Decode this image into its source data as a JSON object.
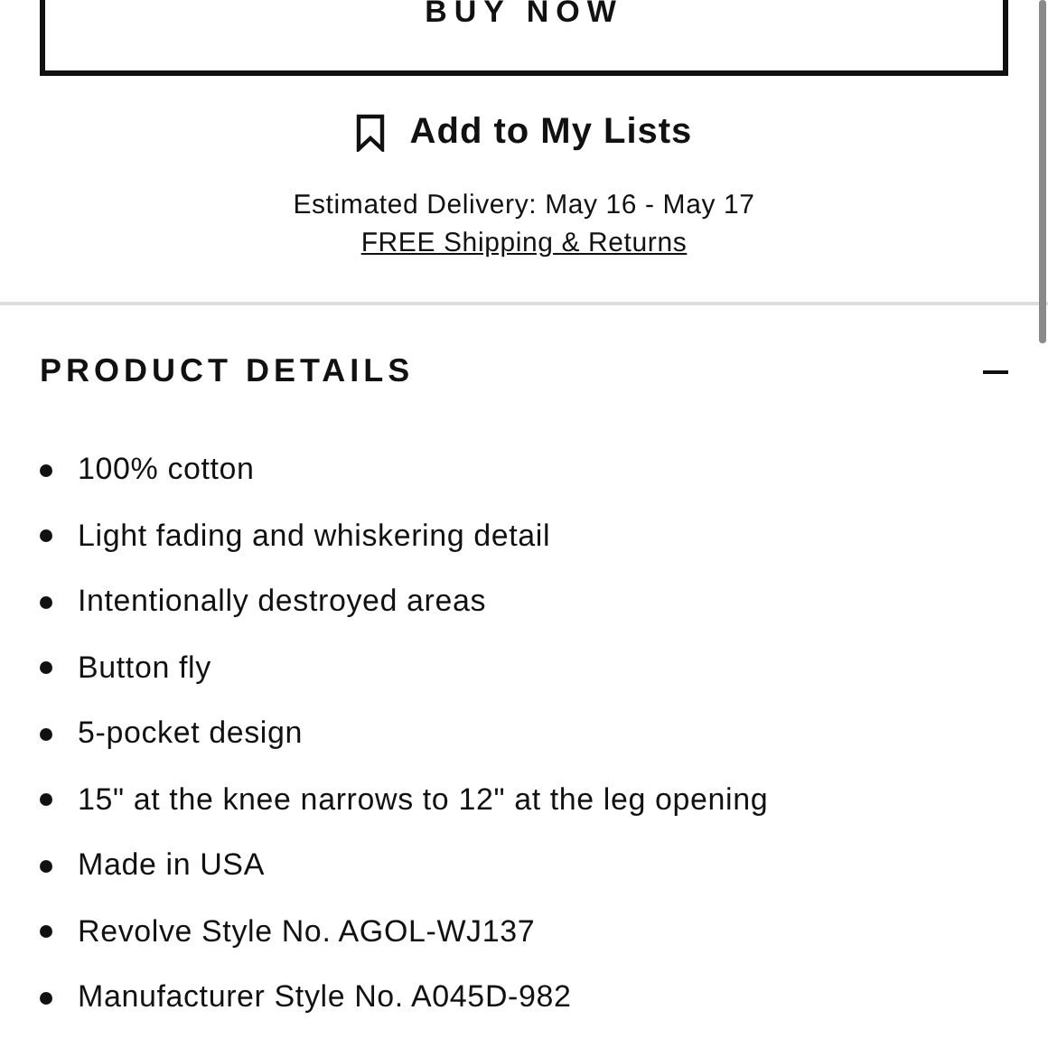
{
  "buy_button": {
    "label": "BUY NOW"
  },
  "add_to_lists": {
    "label": "Add to My Lists"
  },
  "delivery": {
    "estimate": "Estimated Delivery: May 16 - May 17",
    "shipping_link": "FREE Shipping & Returns"
  },
  "product_details": {
    "title": "PRODUCT DETAILS",
    "expanded": true,
    "items": [
      "100% cotton",
      "Light fading and whiskering detail",
      "Intentionally destroyed areas",
      "Button fly",
      "5-pocket design",
      "15\" at the knee narrows to 12\" at the leg opening",
      "Made in USA",
      "Revolve Style No. AGOL-WJ137",
      "Manufacturer Style No. A045D-982"
    ]
  }
}
